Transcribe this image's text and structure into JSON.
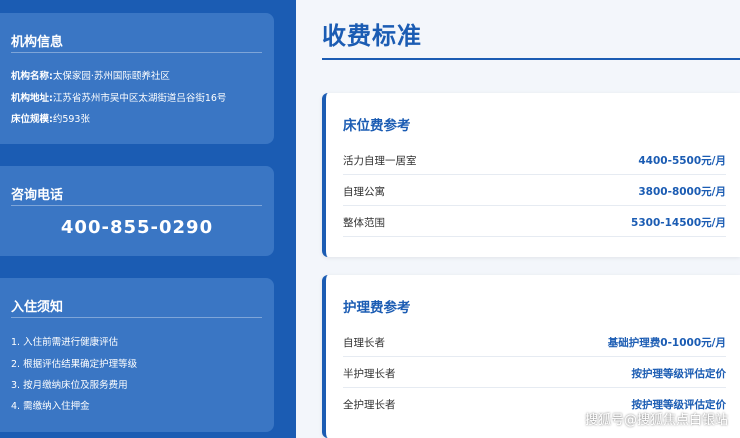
{
  "sidebar": {
    "org": {
      "title": "机构信息",
      "lines": [
        {
          "label": "机构名称:",
          "value": "太保家园·苏州国际颐养社区"
        },
        {
          "label": "机构地址:",
          "value": "江苏省苏州市吴中区太湖街道吕谷街16号"
        },
        {
          "label": "床位规模:",
          "value": "约593张"
        }
      ]
    },
    "contact": {
      "title": "咨询电话",
      "phone": "400-855-0290"
    },
    "notice": {
      "title": "入住须知",
      "items": [
        "1. 入住前需进行健康评估",
        "2. 根据评估结果确定护理等级",
        "3. 按月缴纳床位及服务费用",
        "4. 需缴纳入住押金"
      ]
    }
  },
  "main": {
    "title": "收费标准",
    "bed_fees": {
      "title": "床位费参考",
      "rows": [
        {
          "label": "活力自理一居室",
          "value": "4400-5500元/月"
        },
        {
          "label": "自理公寓",
          "value": "3800-8000元/月"
        },
        {
          "label": "整体范围",
          "value": "5300-14500元/月"
        }
      ]
    },
    "care_fees": {
      "title": "护理费参考",
      "rows": [
        {
          "label": "自理长者",
          "value": "基础护理费0-1000元/月"
        },
        {
          "label": "半护理长者",
          "value": "按护理等级评估定价"
        },
        {
          "label": "全护理长者",
          "value": "按护理等级评估定价"
        }
      ]
    }
  },
  "watermark": "搜狐号@搜狐焦点白银站",
  "colors": {
    "brand": "#1b5cb3",
    "card": "#3a76c4"
  }
}
